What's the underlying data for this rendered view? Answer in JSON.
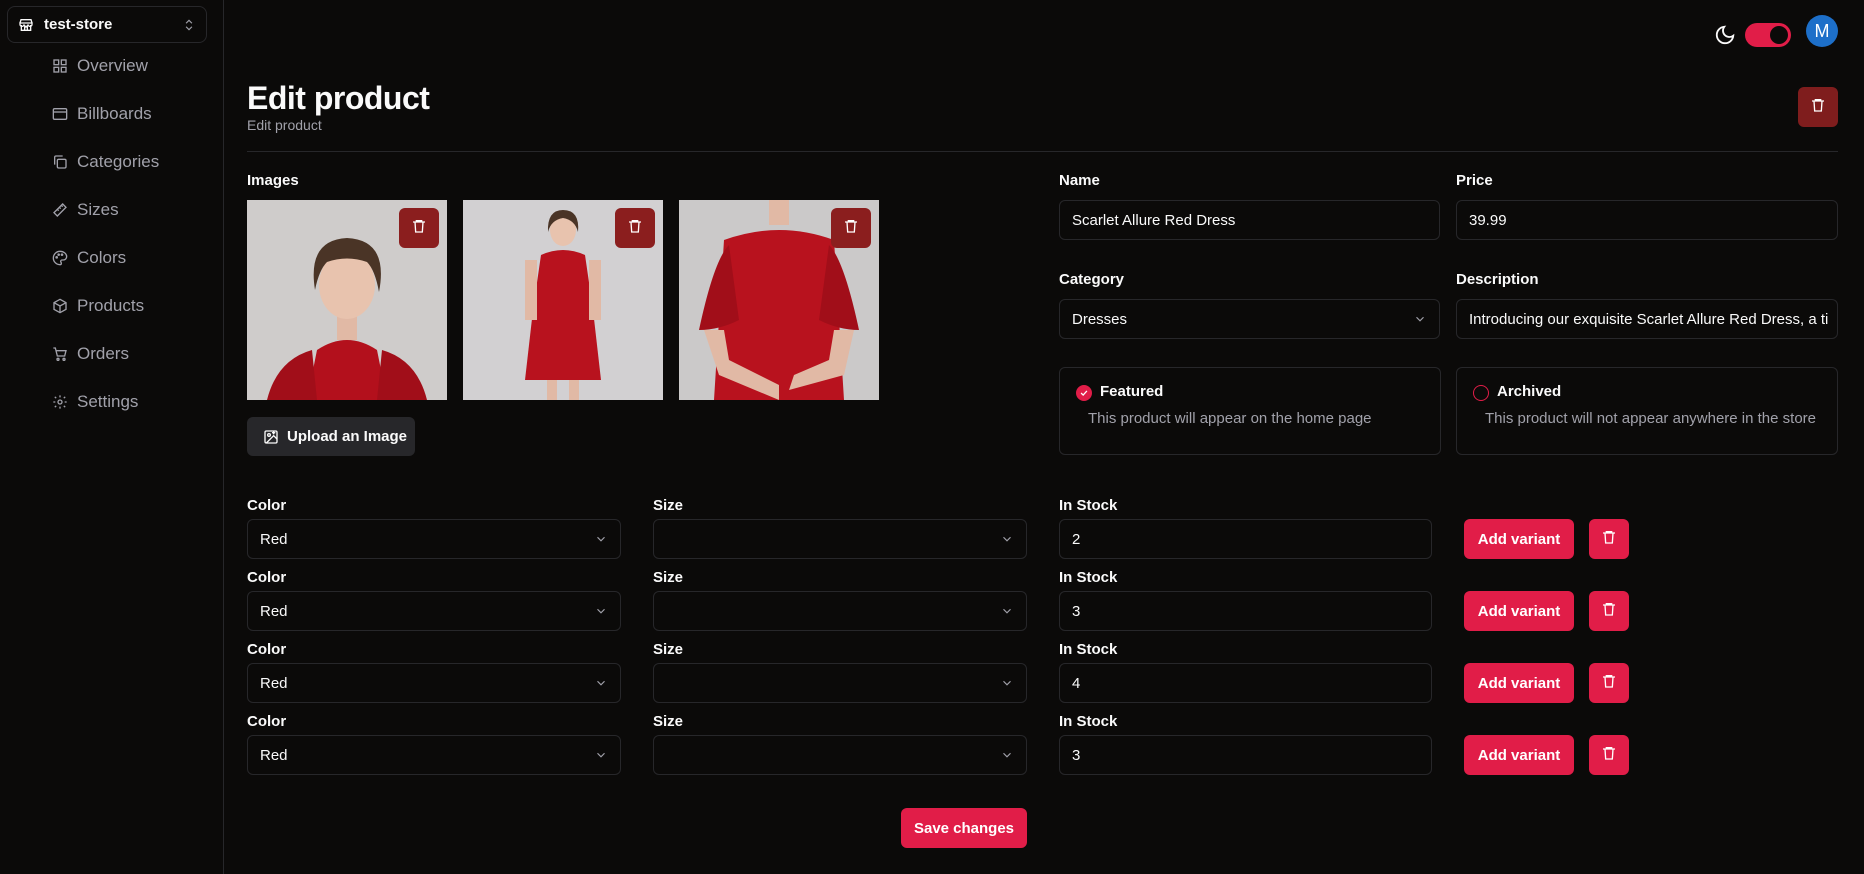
{
  "store_switcher": {
    "name": "test-store"
  },
  "nav": {
    "items": [
      {
        "label": "Overview",
        "icon": "layout-grid-icon"
      },
      {
        "label": "Billboards",
        "icon": "billboard-icon"
      },
      {
        "label": "Categories",
        "icon": "copy-icon"
      },
      {
        "label": "Sizes",
        "icon": "ruler-icon"
      },
      {
        "label": "Colors",
        "icon": "palette-icon"
      },
      {
        "label": "Products",
        "icon": "package-icon"
      },
      {
        "label": "Orders",
        "icon": "cart-icon"
      },
      {
        "label": "Settings",
        "icon": "gear-icon"
      }
    ]
  },
  "header": {
    "avatar_initial": "M",
    "theme_toggle_on": true
  },
  "page": {
    "title": "Edit product",
    "subtitle": "Edit product"
  },
  "images": {
    "label": "Images",
    "items": [
      {
        "alt": "model portrait red dress"
      },
      {
        "alt": "model full body red dress"
      },
      {
        "alt": "model torso red dress"
      }
    ],
    "upload_label": "Upload an Image"
  },
  "form": {
    "name_label": "Name",
    "name_value": "Scarlet Allure Red Dress",
    "price_label": "Price",
    "price_value": "39.99",
    "category_label": "Category",
    "category_value": "Dresses",
    "description_label": "Description",
    "description_value": "Introducing our exquisite Scarlet Allure Red Dress, a ti",
    "featured": {
      "title": "Featured",
      "description": "This product will appear on the home page",
      "checked": true
    },
    "archived": {
      "title": "Archived",
      "description": "This product will not appear anywhere in the store",
      "checked": false
    }
  },
  "variants": {
    "color_label": "Color",
    "size_label": "Size",
    "stock_label": "In Stock",
    "add_label": "Add variant",
    "rows": [
      {
        "color": "Red",
        "size": "",
        "stock": "2"
      },
      {
        "color": "Red",
        "size": "",
        "stock": "3"
      },
      {
        "color": "Red",
        "size": "",
        "stock": "4"
      },
      {
        "color": "Red",
        "size": "",
        "stock": "3"
      }
    ]
  },
  "save_label": "Save changes",
  "colors": {
    "accent": "#e11d48",
    "danger_dark": "#7f1d1d",
    "background": "#0b0a09",
    "avatar": "#1d6fc9"
  }
}
